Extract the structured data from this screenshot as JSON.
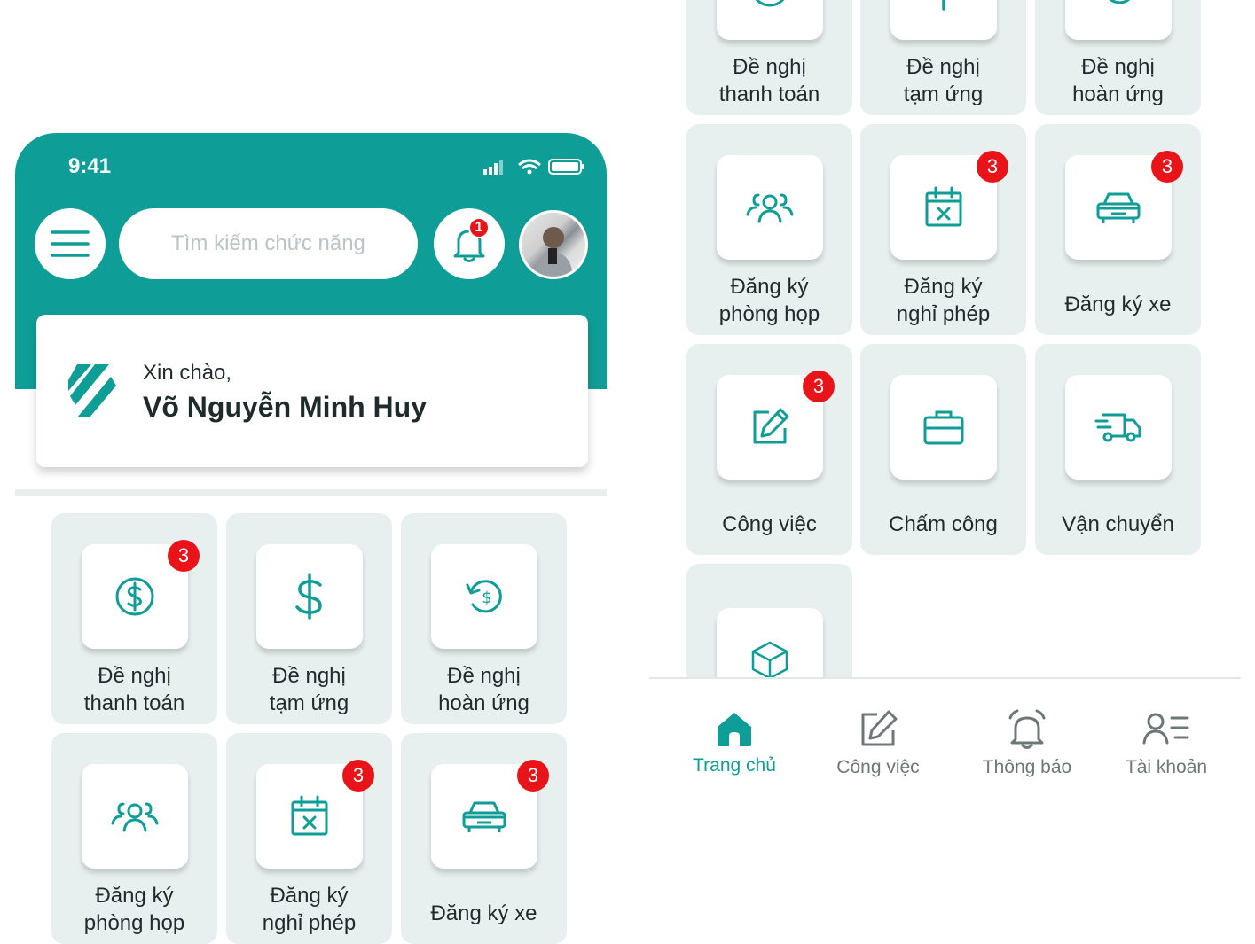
{
  "status": {
    "time": "9:41"
  },
  "header": {
    "search_placeholder": "Tìm kiếm chức năng",
    "notification_count": "1"
  },
  "greeting": {
    "hello": "Xin chào,",
    "name": "Võ Nguyễn Minh Huy"
  },
  "colors": {
    "primary": "#0f9e97",
    "tile_bg": "#e7f0ef",
    "badge": "#e8141a"
  },
  "tiles": [
    {
      "line1": "Đề nghị",
      "line2": "thanh toán",
      "badge": "3",
      "icon": "dollar-circle-icon"
    },
    {
      "line1": "Đề nghị",
      "line2": "tạm ứng",
      "badge": "",
      "icon": "dollar-icon"
    },
    {
      "line1": "Đề nghị",
      "line2": "hoàn ứng",
      "badge": "",
      "icon": "dollar-refund-icon"
    },
    {
      "line1": "Đăng ký",
      "line2": "phòng họp",
      "badge": "",
      "icon": "users-icon"
    },
    {
      "line1": "Đăng ký",
      "line2": "nghỉ phép",
      "badge": "3",
      "icon": "calendar-x-icon"
    },
    {
      "line1": "Đăng ký xe",
      "line2": "",
      "badge": "3",
      "icon": "car-icon"
    },
    {
      "line1": "Công việc",
      "line2": "",
      "badge": "3",
      "icon": "edit-icon"
    },
    {
      "line1": "Chấm công",
      "line2": "",
      "badge": "",
      "icon": "briefcase-icon"
    },
    {
      "line1": "Vận chuyển",
      "line2": "",
      "badge": "",
      "icon": "truck-icon"
    },
    {
      "line1": "",
      "line2": "",
      "badge": "",
      "icon": "box-icon"
    }
  ],
  "bottom_nav": [
    {
      "label": "Trang chủ",
      "icon": "home-icon",
      "active": true
    },
    {
      "label": "Công việc",
      "icon": "edit-icon",
      "active": false
    },
    {
      "label": "Thông báo",
      "icon": "alarm-icon",
      "active": false
    },
    {
      "label": "Tài khoản",
      "icon": "account-icon",
      "active": false
    }
  ]
}
